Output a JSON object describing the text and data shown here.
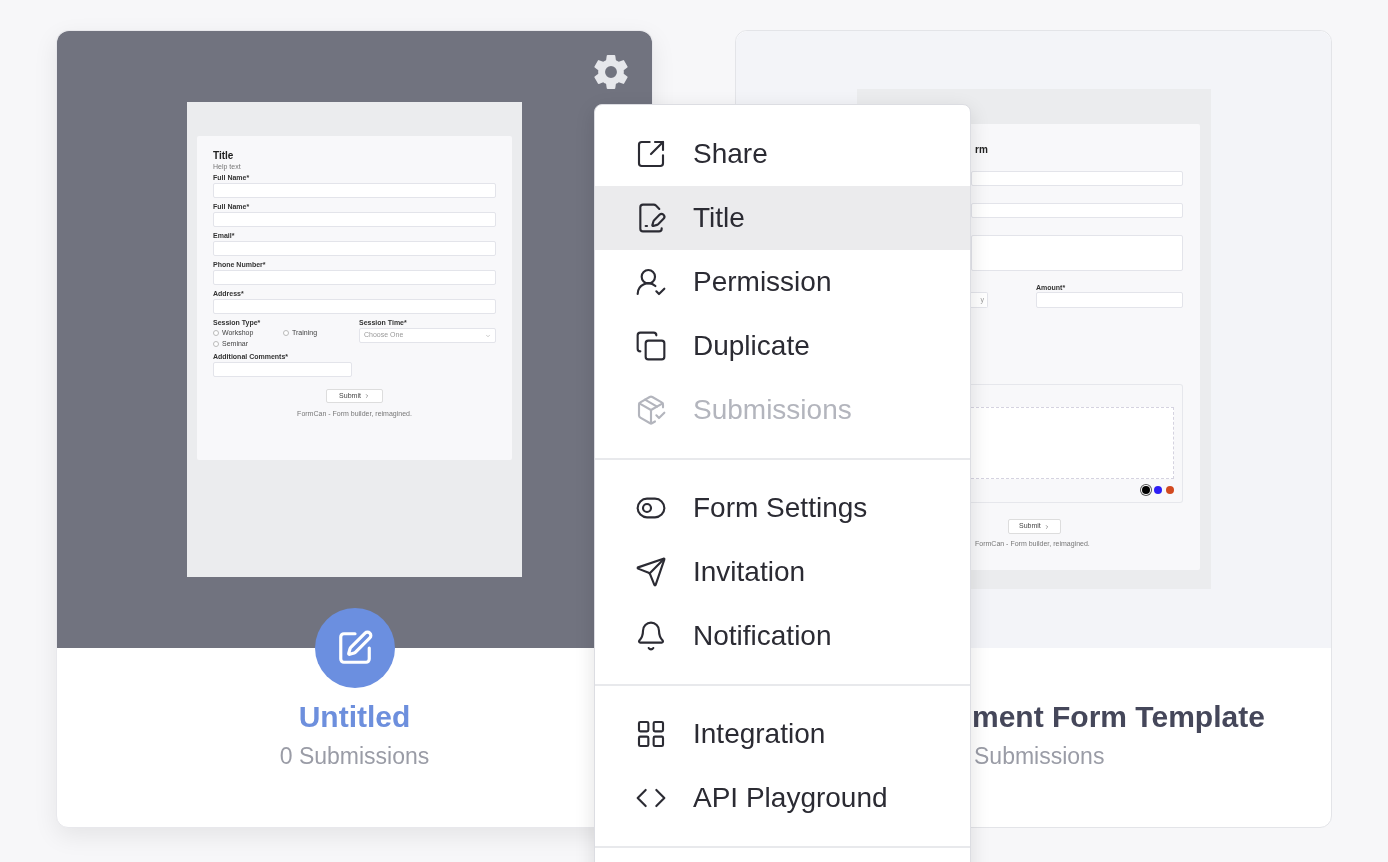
{
  "cards": [
    {
      "selected": true,
      "title": "Untitled",
      "subtitle": "0 Submissions",
      "form": {
        "title": "Title",
        "help": "Help text",
        "fields": [
          {
            "label": "Full Name*"
          },
          {
            "label": "Full Name*"
          },
          {
            "label": "Email*"
          },
          {
            "label": "Phone Number*"
          },
          {
            "label": "Address*"
          }
        ],
        "session_label": "Session Type*",
        "options": [
          {
            "label": "Workshop",
            "selected": false
          },
          {
            "label": "Training",
            "selected": false
          },
          {
            "label": "Seminar",
            "selected": false
          }
        ],
        "time_label": "Session Time*",
        "time_placeholder": "Choose One",
        "comments_label": "Additional Comments*",
        "submit": "Submit",
        "footer": "FormCan - Form builder, reimagined."
      }
    },
    {
      "selected": false,
      "title": "ment Form Template",
      "subtitle": "Submissions",
      "form": {
        "heading": "rm",
        "date_placeholder": "y",
        "amount_label": "Amount*",
        "pens": [
          {
            "color": "#000000",
            "selected": true
          },
          {
            "color": "#2d1ef5",
            "selected": false
          },
          {
            "color": "#d2491f",
            "selected": false
          }
        ],
        "submit": "Submit",
        "footer": "FormCan - Form builder, reimagined."
      }
    }
  ],
  "menu": {
    "groups": [
      [
        {
          "label": "Share",
          "selected": false,
          "disabled": false
        },
        {
          "label": "Title",
          "selected": true,
          "disabled": false
        },
        {
          "label": "Permission",
          "selected": false,
          "disabled": false
        },
        {
          "label": "Duplicate",
          "selected": false,
          "disabled": false
        },
        {
          "label": "Submissions",
          "selected": false,
          "disabled": true
        }
      ],
      [
        {
          "label": "Form Settings",
          "selected": false,
          "disabled": false
        },
        {
          "label": "Invitation",
          "selected": false,
          "disabled": false
        },
        {
          "label": "Notification",
          "selected": false,
          "disabled": false
        }
      ],
      [
        {
          "label": "Integration",
          "selected": false,
          "disabled": false
        },
        {
          "label": "API Playground",
          "selected": false,
          "disabled": false
        }
      ]
    ]
  }
}
